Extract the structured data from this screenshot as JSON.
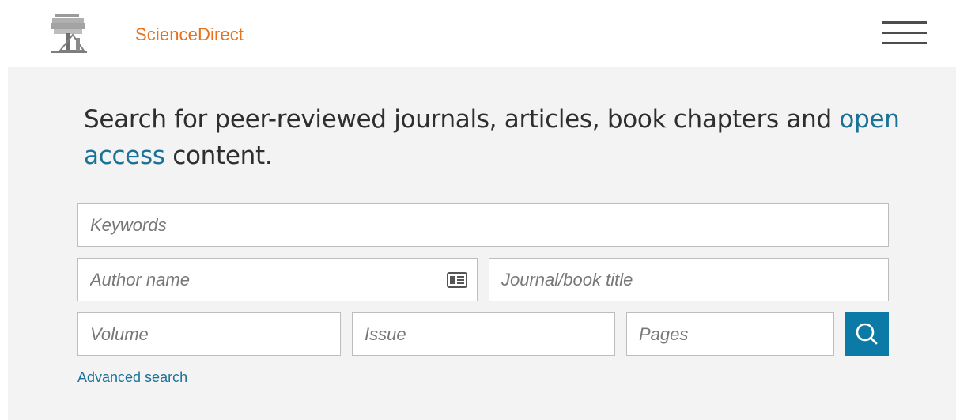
{
  "header": {
    "brand": "ScienceDirect",
    "logo_icon": "elsevier-tree-logo",
    "menu_icon": "hamburger-menu-icon"
  },
  "intro": {
    "text_before": "Search for peer-reviewed journals, articles, book chapters and ",
    "link_text": "open access",
    "text_after": " content."
  },
  "search": {
    "keywords_placeholder": "Keywords",
    "author_placeholder": "Author name",
    "author_icon": "contact-card-icon",
    "journal_placeholder": "Journal/book title",
    "volume_placeholder": "Volume",
    "issue_placeholder": "Issue",
    "pages_placeholder": "Pages",
    "submit_icon": "search-icon"
  },
  "advanced_search_label": "Advanced search",
  "colors": {
    "brand_orange": "#e9711c",
    "link_blue": "#1a7299",
    "button_blue": "#0c7aa6",
    "panel_bg": "#f3f3f3"
  }
}
